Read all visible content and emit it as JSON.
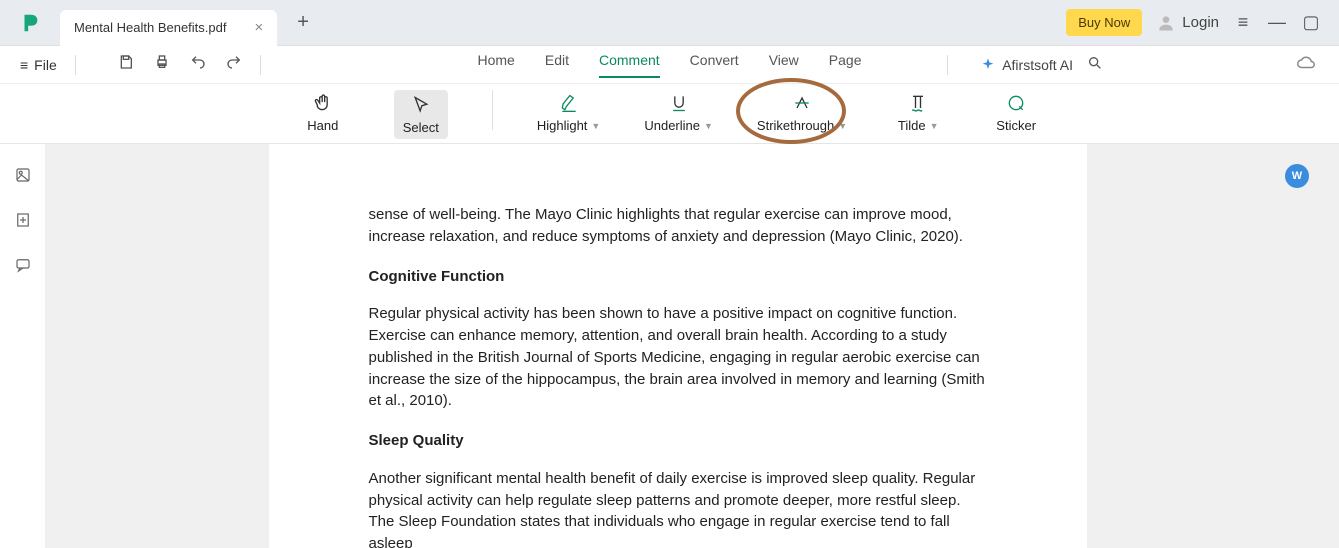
{
  "titlebar": {
    "tab_name": "Mental Health Benefits.pdf",
    "buy_now": "Buy Now",
    "login": "Login"
  },
  "menubar": {
    "file": "File",
    "tabs": {
      "home": "Home",
      "edit": "Edit",
      "comment": "Comment",
      "convert": "Convert",
      "view": "View",
      "page": "Page"
    },
    "ai": "Afirstsoft AI"
  },
  "toolbar": {
    "hand": "Hand",
    "select": "Select",
    "highlight": "Highlight",
    "underline": "Underline",
    "strikethrough": "Strikethrough",
    "tilde": "Tilde",
    "sticker": "Sticker"
  },
  "document": {
    "p1": "sense of well-being. The Mayo Clinic highlights that regular exercise can improve mood, increase relaxation, and reduce symptoms of anxiety and depression (Mayo Clinic, 2020).",
    "h1": "Cognitive Function",
    "p2": "Regular physical activity has been shown to have a positive impact on cognitive function. Exercise can enhance memory, attention, and overall brain health. According to a study published in the British Journal of Sports Medicine, engaging in regular aerobic exercise can increase the size of the hippocampus, the brain area involved in memory and learning (Smith et al., 2010).",
    "h2": "Sleep Quality",
    "p3": "Another significant mental health benefit of daily exercise is improved sleep quality. Regular physical activity can help regulate sleep patterns and promote deeper, more restful sleep. The Sleep Foundation states that individuals who engage in regular exercise tend to fall asleep"
  },
  "float_badge": "W"
}
